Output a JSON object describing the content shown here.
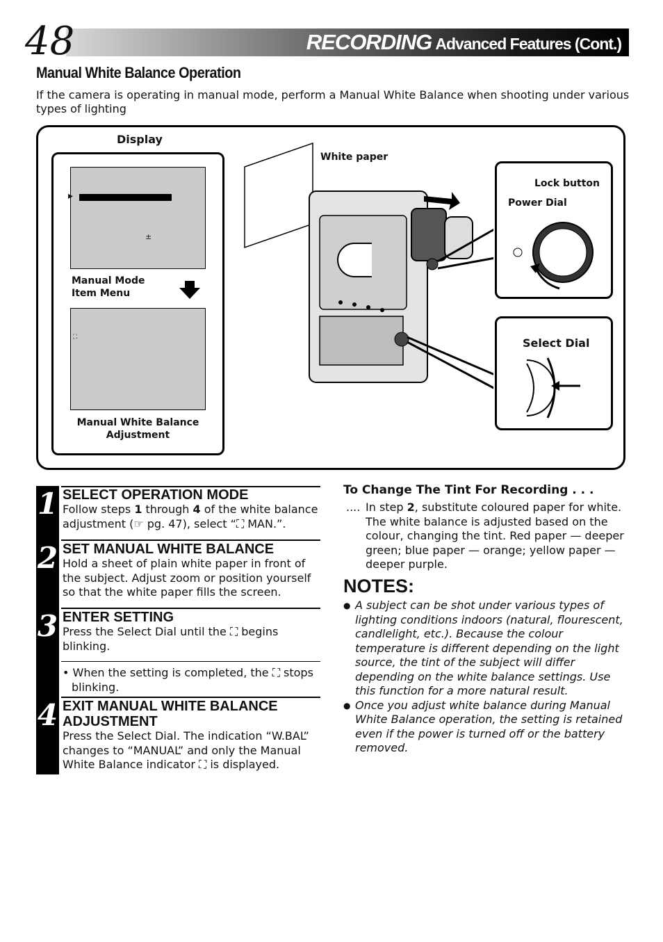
{
  "header": {
    "page_number": "48",
    "title_main": "RECORDING",
    "title_sub": "Advanced Features (Cont.)"
  },
  "section": {
    "title": "Manual White Balance Operation",
    "intro": "If the camera is operating in manual mode, perform a Manual White Balance when shooting under various types of lighting"
  },
  "figure": {
    "display_label": "Display",
    "screen1_caption_line1": "Manual Mode",
    "screen1_caption_line2": "Item Menu",
    "screen1_symbol": "±",
    "screen2_caption_line1": "Manual White Balance",
    "screen2_caption_line2": "Adjustment",
    "white_paper": "White paper",
    "lock_button": "Lock button",
    "power_dial": "Power Dial",
    "select_dial": "Select Dial"
  },
  "steps": [
    {
      "num": "1",
      "title": "SELECT OPERATION MODE",
      "body_parts": [
        "Follow steps ",
        "1",
        " through ",
        "4",
        " of the white balance adjustment (☞ pg. 47), select “",
        "MAN.”."
      ]
    },
    {
      "num": "2",
      "title": "SET MANUAL WHITE BALANCE",
      "body": "Hold a sheet of plain white paper in front of the subject. Adjust zoom or position yourself so that the white paper fills the screen."
    },
    {
      "num": "3",
      "title": "ENTER SETTING",
      "body_a": "Press the Select Dial until the",
      "body_b": "begins blinking.",
      "bullet_a": "• When the setting is completed, the",
      "bullet_b": "stops blinking."
    },
    {
      "num": "4",
      "title_line1": "EXIT MANUAL WHITE BALANCE",
      "title_line2": "ADJUSTMENT",
      "body_a": "Press the Select Dial. The indication “W.BAL” changes to “MANUAL” and only the Manual White Balance indicator",
      "body_b": "is displayed."
    }
  ],
  "tint": {
    "title": "To Change The Tint For Recording . . .",
    "lead": "....",
    "body_a": "In step ",
    "body_bold": "2",
    "body_b": ", substitute coloured paper for white. The white balance is adjusted based on the colour, changing the tint. Red paper — deeper green; blue paper — orange; yellow paper — deeper purple."
  },
  "notes": {
    "title": "NOTES:",
    "items": [
      "A subject can be shot under various types of lighting conditions indoors (natural, flourescent, candlelight, etc.). Because the colour temperature is different depending on the light source, the tint of the subject will differ depending on the white balance settings. Use this function for a more natural result.",
      "Once you adjust white balance during Manual White Balance operation, the setting is retained even if the power is turned off or the battery removed."
    ]
  },
  "icons": {
    "wb": "manual-white-balance-icon",
    "hand": "pointing-hand-icon"
  }
}
